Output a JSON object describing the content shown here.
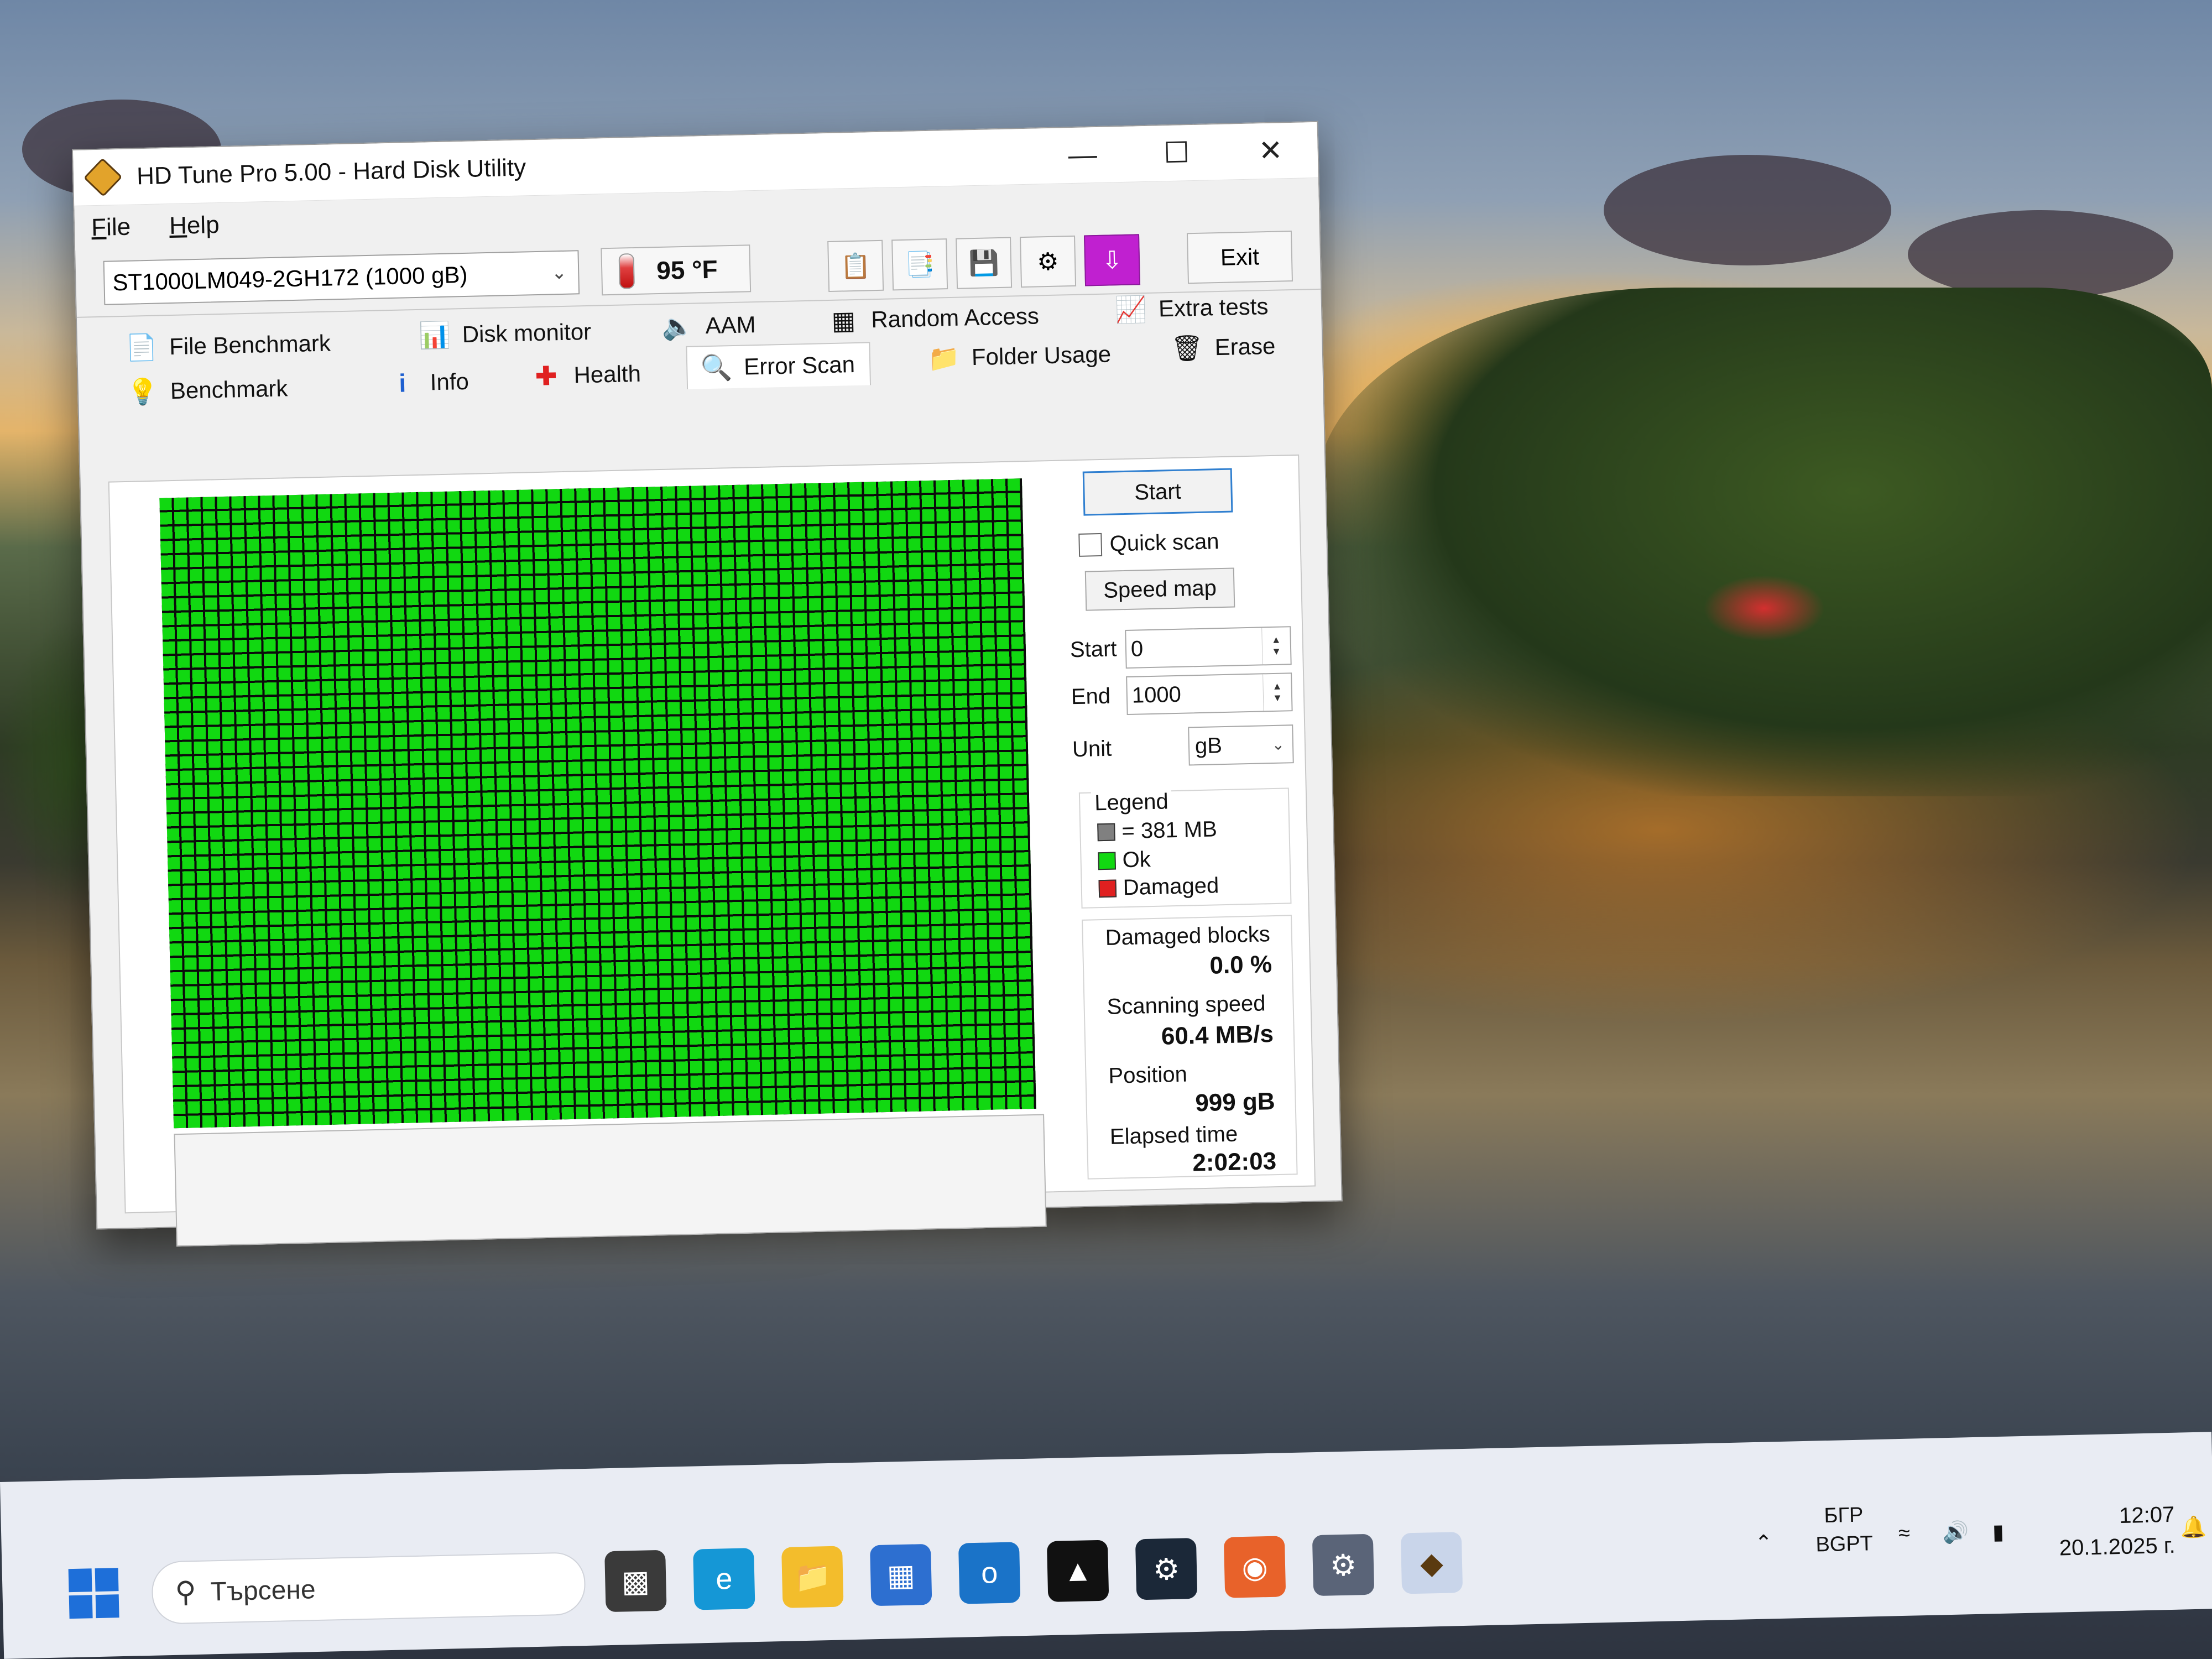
{
  "window": {
    "title": "HD Tune Pro 5.00 - Hard Disk Utility",
    "controls": {
      "minimize": "—",
      "maximize": "☐",
      "close": "✕"
    }
  },
  "menu": {
    "file": {
      "accel": "F",
      "rest": "ile"
    },
    "help": {
      "accel": "H",
      "rest": "elp"
    }
  },
  "toolbar": {
    "drive": "ST1000LM049-2GH172 (1000 gB)",
    "temperature": "95 °F",
    "exit_label": "Exit"
  },
  "tabs": {
    "row1": [
      "File Benchmark",
      "Disk monitor",
      "AAM",
      "Random Access",
      "Extra tests"
    ],
    "row2": [
      "Benchmark",
      "Info",
      "Health",
      "Error Scan",
      "Folder Usage",
      "Erase"
    ],
    "active": "Error Scan"
  },
  "error_scan": {
    "start_button": "Start",
    "quick_scan_label": "Quick scan",
    "quick_scan_checked": false,
    "speed_map_button": "Speed map",
    "start_label": "Start",
    "start_value": "0",
    "end_label": "End",
    "end_value": "1000",
    "unit_label": "Unit",
    "unit_value": "gB",
    "legend": {
      "title": "Legend",
      "block": "= 381 MB",
      "ok": "Ok",
      "damaged": "Damaged",
      "colors": {
        "block": "#808080",
        "ok": "#11d811",
        "damaged": "#e02020"
      }
    },
    "stats": {
      "damaged_blocks_label": "Damaged blocks",
      "damaged_blocks_value": "0.0 %",
      "scanning_speed_label": "Scanning speed",
      "scanning_speed_value": "60.4 MB/s",
      "position_label": "Position",
      "position_value": "999 gB",
      "elapsed_label": "Elapsed time",
      "elapsed_value": "2:02:03"
    },
    "map_color": "#11d811"
  },
  "taskbar": {
    "search_placeholder": "Търсене",
    "language_top": "БГР",
    "language_bottom": "BGPT",
    "time": "12:07",
    "date": "20.1.2025 г."
  }
}
